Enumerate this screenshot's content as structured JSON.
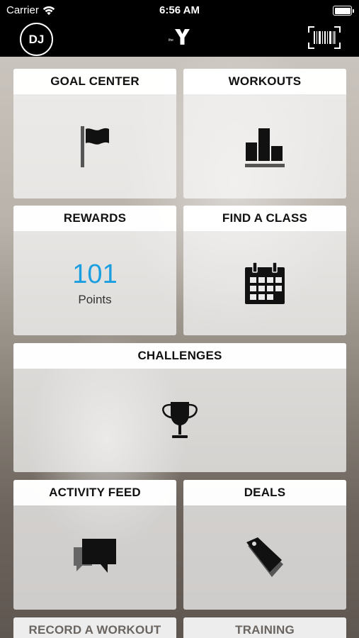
{
  "status_bar": {
    "carrier": "Carrier",
    "time": "6:56 AM"
  },
  "nav": {
    "avatar_initials": "DJ",
    "logo_icon": "ymca-logo-icon",
    "barcode_icon": "barcode-icon"
  },
  "tiles": {
    "goal_center": {
      "label": "GOAL CENTER",
      "icon": "flag-icon"
    },
    "workouts": {
      "label": "WORKOUTS",
      "icon": "bar-chart-icon"
    },
    "rewards": {
      "label": "REWARDS",
      "points_value": "101",
      "points_label": "Points"
    },
    "find_a_class": {
      "label": "FIND A CLASS",
      "icon": "calendar-icon"
    },
    "challenges": {
      "label": "CHALLENGES",
      "icon": "trophy-icon"
    },
    "activity_feed": {
      "label": "ACTIVITY FEED",
      "icon": "chat-bubbles-icon"
    },
    "deals": {
      "label": "DEALS",
      "icon": "price-tag-icon"
    },
    "record_a_workout": {
      "label": "RECORD A WORKOUT"
    },
    "training": {
      "label": "TRAINING"
    }
  },
  "colors": {
    "accent": "#1a9ee0",
    "bar_background": "#000000",
    "tile_header": "#ffffff"
  }
}
